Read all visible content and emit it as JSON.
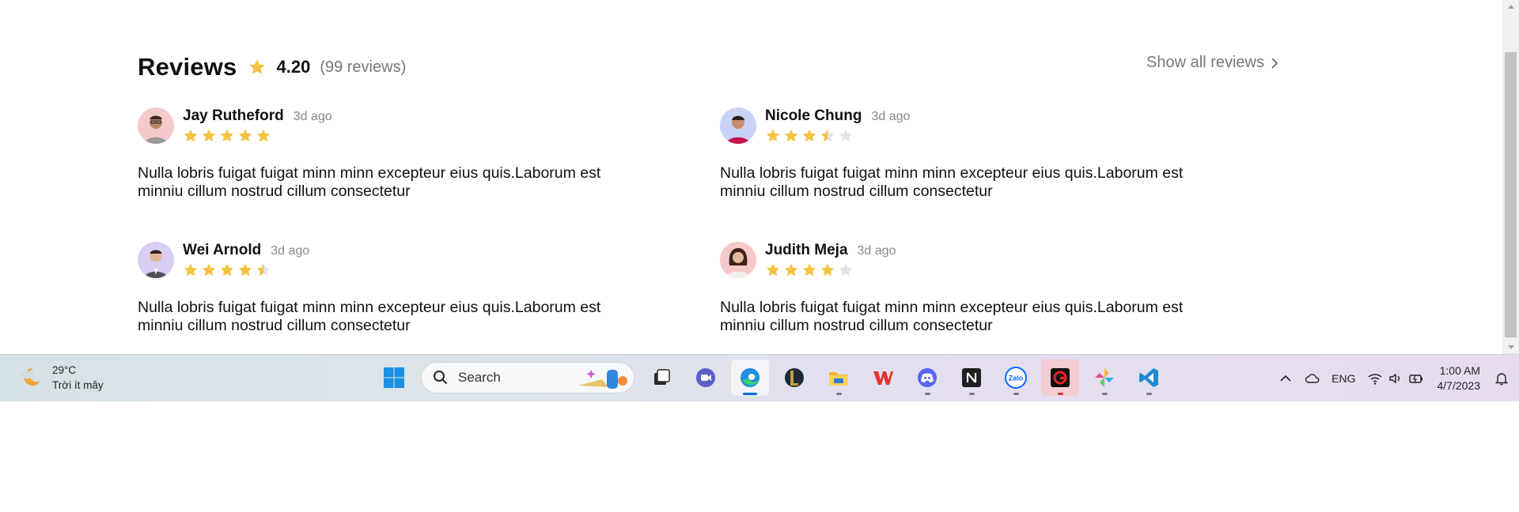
{
  "reviews": {
    "title": "Reviews",
    "rating": "4.20",
    "count_text": "(99 reviews)",
    "show_all_label": "Show all reviews",
    "items": [
      {
        "name": "Jay Rutheford",
        "date": "3d ago",
        "rating": 5,
        "text": "Nulla lobris fuigat fuigat minn minn excepteur eius quis.Laborum est minniu cillum nostrud cillum consectetur",
        "avatar_bg": "#f6c9c9"
      },
      {
        "name": "Nicole Chung",
        "date": "3d ago",
        "rating": 3.5,
        "text": "Nulla lobris fuigat fuigat minn minn excepteur eius quis.Laborum est minniu cillum nostrud cillum consectetur",
        "avatar_bg": "#c9d3f6"
      },
      {
        "name": "Wei Arnold",
        "date": "3d ago",
        "rating": 4.5,
        "text": "Nulla lobris fuigat fuigat minn minn excepteur eius quis.Laborum est minniu cillum nostrud cillum consectetur",
        "avatar_bg": "#d9cdf2"
      },
      {
        "name": "Judith Meja",
        "date": "3d ago",
        "rating": 4,
        "text": "Nulla lobris fuigat fuigat minn minn excepteur eius quis.Laborum est minniu cillum nostrud cillum consectetur",
        "avatar_bg": "#f6c9c9"
      }
    ]
  },
  "colors": {
    "star": "#f5c341",
    "star_empty": "#e3e3e3",
    "muted": "#777777"
  },
  "taskbar": {
    "weather": {
      "temp": "29°C",
      "desc": "Trời ít mây"
    },
    "search_placeholder": "Search",
    "apps": [
      "windows-start",
      "task-view",
      "meet",
      "edge",
      "league-of-legends",
      "file-explorer",
      "wps-office",
      "discord",
      "notion",
      "zalo",
      "garena",
      "pinwheel-app",
      "vs-code"
    ],
    "tray": {
      "language": "ENG",
      "time": "1:00 AM",
      "date": "4/7/2023"
    }
  }
}
